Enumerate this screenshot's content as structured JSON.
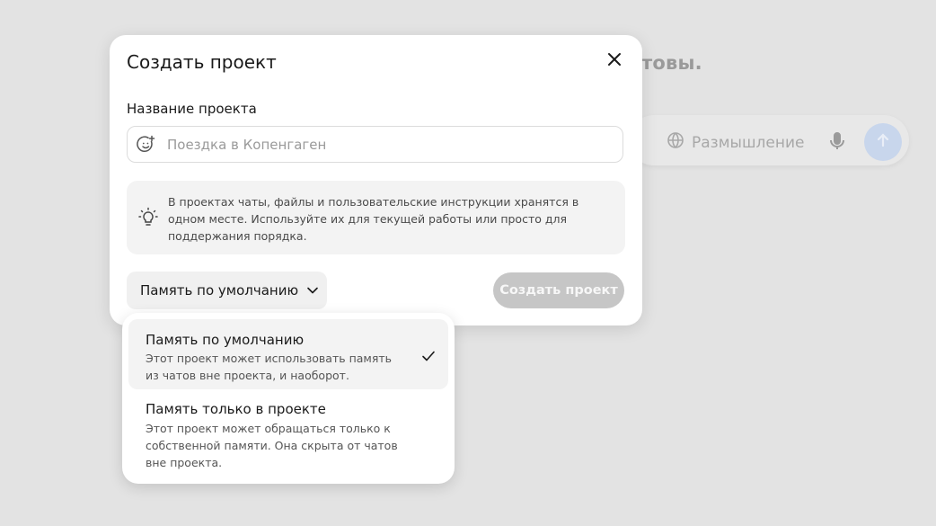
{
  "background": {
    "heading_fragment": "товы.",
    "composer": {
      "think_label": "Размышление",
      "think_icon": "globe-icon",
      "mic_icon": "mic-icon",
      "send_icon": "arrow-up-icon"
    }
  },
  "modal": {
    "title": "Создать проект",
    "close_icon": "close-icon",
    "name_label": "Название проекта",
    "name_placeholder": "Поездка в Копенгаген",
    "name_value": "",
    "emoji_icon": "emoji-add-icon",
    "info_icon": "lightbulb-icon",
    "info_text": "В проектах чаты, файлы и пользовательские инструкции хранятся в одном месте. Используйте их для текущей работы или просто для поддержания порядка.",
    "memory_selected": "Память по умолчанию",
    "create_label": "Создать проект",
    "colors": {
      "create_disabled_bg": "#c6c6c6",
      "backdrop": "#e3e3e3"
    }
  },
  "dropdown": {
    "options": [
      {
        "title": "Память по умолчанию",
        "description": "Этот проект может использовать память из чатов вне проекта, и наоборот.",
        "selected": true
      },
      {
        "title": "Память только в проекте",
        "description": "Этот проект может обращаться только к собственной памяти. Она скрыта от чатов вне проекта.",
        "selected": false
      }
    ]
  }
}
